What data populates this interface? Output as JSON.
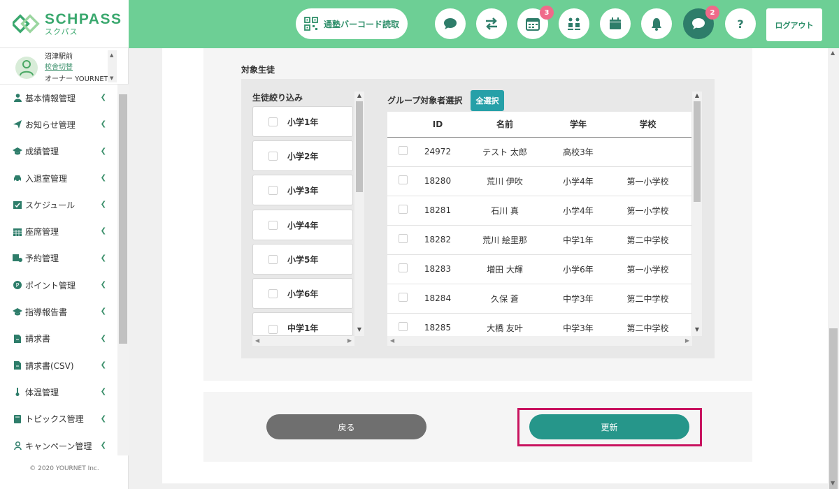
{
  "header": {
    "logo_text": "SCHPASS",
    "logo_sub": "スクパス",
    "barcode_label": "通塾バーコード読取",
    "calendar_badge": "3",
    "chat_badge": "2",
    "help_label": "?",
    "logout_label": "ログアウト"
  },
  "sidebar": {
    "school_name": "沼津駅前",
    "school_switch": "校舎切替",
    "owner": "オーナー YOURNET",
    "items": [
      {
        "label": "基本情報管理",
        "icon": "person-icon"
      },
      {
        "label": "お知らせ管理",
        "icon": "paper-plane-icon"
      },
      {
        "label": "成績管理",
        "icon": "graduation-cap-icon"
      },
      {
        "label": "入退室管理",
        "icon": "car-icon"
      },
      {
        "label": "スケジュール",
        "icon": "calendar-check-icon"
      },
      {
        "label": "座席管理",
        "icon": "calendar-grid-icon"
      },
      {
        "label": "予約管理",
        "icon": "reservation-icon"
      },
      {
        "label": "ポイント管理",
        "icon": "point-icon"
      },
      {
        "label": "指導報告書",
        "icon": "graduation-cap-icon"
      },
      {
        "label": "請求書",
        "icon": "invoice-icon"
      },
      {
        "label": "請求書(CSV)",
        "icon": "invoice-icon"
      },
      {
        "label": "体温管理",
        "icon": "thermometer-icon"
      },
      {
        "label": "トピックス管理",
        "icon": "book-icon"
      },
      {
        "label": "キャンペーン管理",
        "icon": "user-outline-icon"
      }
    ],
    "copyright": "© 2020 YOURNET Inc."
  },
  "main": {
    "target_label": "対象生徒",
    "filter_title": "生徒絞り込み",
    "grades": [
      "小学1年",
      "小学2年",
      "小学3年",
      "小学4年",
      "小学5年",
      "小学6年",
      "中学1年"
    ],
    "group_title": "グループ対象者選択",
    "select_all": "全選択",
    "table": {
      "headers": [
        "ID",
        "名前",
        "学年",
        "学校"
      ],
      "rows": [
        [
          "24972",
          "テスト 太郎",
          "高校3年",
          ""
        ],
        [
          "18280",
          "荒川 伊吹",
          "小学4年",
          "第一小学校"
        ],
        [
          "18281",
          "石川 真",
          "小学4年",
          "第一小学校"
        ],
        [
          "18282",
          "荒川 絵里那",
          "中学1年",
          "第二中学校"
        ],
        [
          "18283",
          "増田 大輝",
          "小学6年",
          "第一小学校"
        ],
        [
          "18284",
          "久保 蒼",
          "中学3年",
          "第二中学校"
        ],
        [
          "18285",
          "大橋 友叶",
          "中学3年",
          "第二中学校"
        ]
      ]
    },
    "back_label": "戻る",
    "update_label": "更新"
  },
  "colors": {
    "header_green": "#6dcf95",
    "brand_green": "#3aa86e",
    "accent_teal": "#26968a",
    "select_all_teal": "#26a0a8",
    "badge_pink": "#f06a8a",
    "highlight": "#c8135f"
  }
}
